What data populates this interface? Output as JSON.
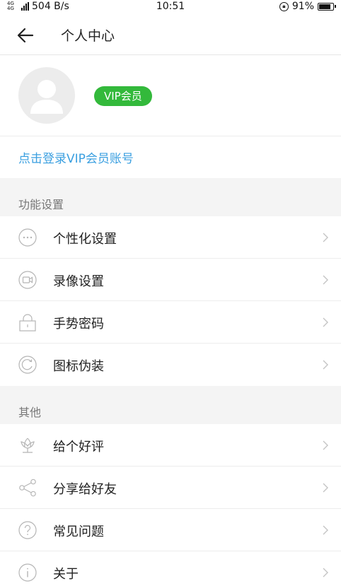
{
  "status_bar": {
    "network": "4G 4G",
    "speed": "504 B/s",
    "time": "10:51",
    "battery": "91%",
    "battery_level": 0.91
  },
  "header": {
    "title": "个人中心"
  },
  "profile": {
    "vip_label": "VIP会员",
    "login_link": "点击登录VIP会员账号"
  },
  "sections": {
    "features": {
      "title": "功能设置",
      "items": [
        {
          "label": "个性化设置",
          "icon": "more-dots-icon"
        },
        {
          "label": "录像设置",
          "icon": "video-camera-icon"
        },
        {
          "label": "手势密码",
          "icon": "lock-icon"
        },
        {
          "label": "图标伪装",
          "icon": "refresh-icon"
        }
      ]
    },
    "other": {
      "title": "其他",
      "items": [
        {
          "label": "给个好评",
          "icon": "flower-icon"
        },
        {
          "label": "分享给好友",
          "icon": "share-icon"
        },
        {
          "label": "常见问题",
          "icon": "question-icon"
        },
        {
          "label": "关于",
          "icon": "info-icon"
        }
      ]
    }
  }
}
